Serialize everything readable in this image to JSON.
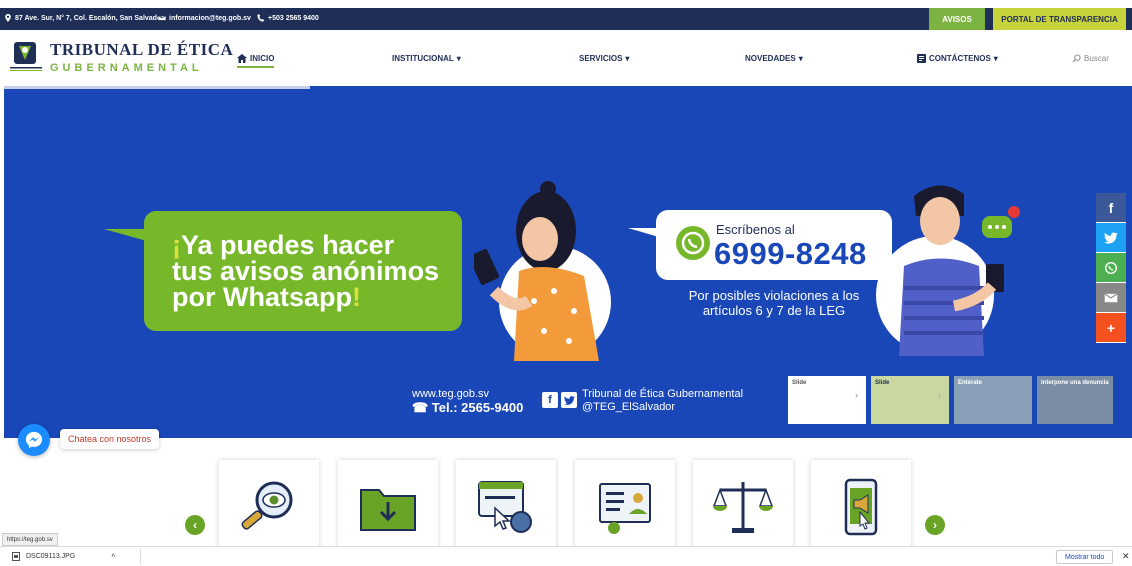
{
  "topbar": {
    "address": "87 Ave. Sur, N° 7, Col. Escalón, San Salvador",
    "email": "informacion@teg.gob.sv",
    "phone": "+503 2565 9400",
    "avisos": "AVISOS",
    "portal": "PORTAL DE TRANSPARENCIA"
  },
  "logo": {
    "line1": "TRIBUNAL DE ÉTICA",
    "line2": "GUBERNAMENTAL"
  },
  "nav": {
    "inicio": "INICIO",
    "institucional": "INSTITUCIONAL",
    "servicios": "SERVICIOS",
    "novedades": "NOVEDADES",
    "contactenos": "CONTÁCTENOS",
    "buscar": "Buscar"
  },
  "hero": {
    "green_line1_mark": "¡",
    "green_line1": "Ya puedes hacer",
    "green_line2": "tus avisos anónimos",
    "green_line3": "por Whatsapp",
    "green_line3_mark": "!",
    "escribenos": "Escríbenos al",
    "whatsapp_number": "6999-8248",
    "posibles_line1": "Por posibles violaciones a los",
    "posibles_line2": "artículos 6 y 7 de la LEG",
    "website": "www.teg.gob.sv",
    "tel": "☎ Tel.: 2565-9400",
    "org_name": "Tribunal de Ética Gubernamental",
    "handle": "@TEG_ElSalvador"
  },
  "thumbs": [
    {
      "label": "Slide"
    },
    {
      "label": "Slide"
    },
    {
      "label": "Entérate"
    },
    {
      "label": "Interpone una denuncia"
    }
  ],
  "chat": {
    "label": "Chatea con nosotros"
  },
  "status": {
    "url": "https://teg.gob.sv"
  },
  "download": {
    "file": "DSC09113.JPG",
    "show_all": "Mostrar todo"
  },
  "colors": {
    "navy": "#1f2e57",
    "blue": "#1a47b8",
    "green": "#76b82a",
    "yellow": "#c8d23b"
  }
}
